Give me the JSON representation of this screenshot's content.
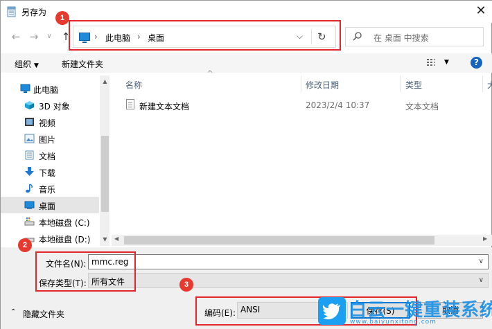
{
  "window": {
    "title": "另存为",
    "close_glyph": "✕"
  },
  "nav": {
    "back_glyph": "←",
    "forward_glyph": "→",
    "history_glyph": "∨",
    "up_glyph": "↑"
  },
  "address": {
    "items": [
      "此电脑",
      "桌面"
    ],
    "separator": "›",
    "dropdown_glyph": "⌵",
    "refresh_glyph": "↻"
  },
  "search": {
    "placeholder": "在 桌面 中搜索"
  },
  "callouts": [
    "1",
    "2",
    "3"
  ],
  "toolbar": {
    "organize": "组织",
    "new_folder": "新建文件夹",
    "help": "?"
  },
  "tree": [
    {
      "label": "此电脑",
      "icon": "computer-icon"
    },
    {
      "label": "3D 对象",
      "icon": "cube-icon"
    },
    {
      "label": "视频",
      "icon": "video-icon"
    },
    {
      "label": "图片",
      "icon": "picture-icon"
    },
    {
      "label": "文档",
      "icon": "document-icon"
    },
    {
      "label": "下载",
      "icon": "download-icon"
    },
    {
      "label": "音乐",
      "icon": "music-icon"
    },
    {
      "label": "桌面",
      "icon": "desktop-icon",
      "selected": true
    },
    {
      "label": "本地磁盘 (C:)",
      "icon": "drive-icon"
    },
    {
      "label": "本地磁盘 (D:)",
      "icon": "drive-icon"
    }
  ],
  "columns": {
    "name": "名称",
    "modified": "修改日期",
    "type": "类型",
    "size": "大"
  },
  "files": [
    {
      "name": "新建文本文档",
      "modified": "2023/2/4 10:37",
      "type": "文本文档"
    }
  ],
  "save_form": {
    "filename_label": "文件名(N):",
    "filename_value": "mmc.reg",
    "filetype_label": "保存类型(T):",
    "filetype_value": "所有文件",
    "encoding_label": "编码(E):",
    "encoding_value": "ANSI",
    "save_button": "保存(S)",
    "cancel_button": "取消"
  },
  "hide_folders": "隐藏文件夹",
  "watermark": {
    "text": "白云一键重装系统",
    "url": "www.baiyunxitong.com"
  },
  "colors": {
    "callout_red": "#e0262b",
    "accent_blue": "#0078d7",
    "watermark_blue": "#1a8fe5"
  }
}
